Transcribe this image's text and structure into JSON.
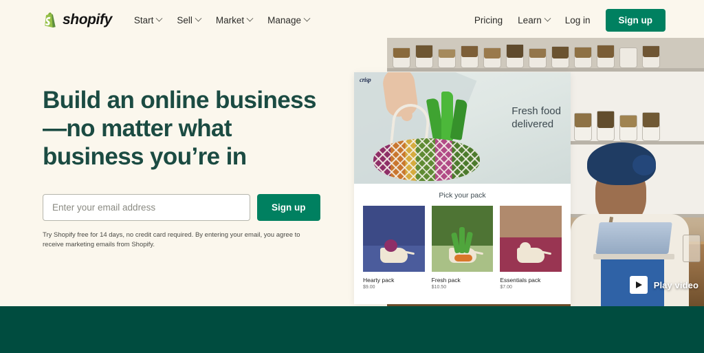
{
  "colors": {
    "page_background": "#fbf7ed",
    "brand_green": "#008060",
    "headline_green": "#1b4b42",
    "footer_band": "#004c3f"
  },
  "nav": {
    "logo_text": "shopify",
    "logo_icon": "shopify-bag-icon",
    "links": [
      {
        "label": "Start",
        "icon": "chevron-down-icon"
      },
      {
        "label": "Sell",
        "icon": "chevron-down-icon"
      },
      {
        "label": "Market",
        "icon": "chevron-down-icon"
      },
      {
        "label": "Manage",
        "icon": "chevron-down-icon"
      }
    ],
    "right": {
      "pricing": "Pricing",
      "learn": "Learn",
      "learn_icon": "chevron-down-icon",
      "login": "Log in",
      "signup": "Sign up"
    }
  },
  "hero": {
    "headline_line1": "Build an online business",
    "headline_line2": "—no matter what",
    "headline_line3": "business you’re in",
    "email_placeholder": "Enter your email address",
    "email_value": "",
    "signup_button": "Sign up",
    "disclaimer": "Try Shopify free for 14 days, no credit card required. By entering your email, you agree to receive marketing emails from Shopify."
  },
  "product_card": {
    "store_logo": "crisp",
    "tagline_line1": "Fresh food",
    "tagline_line2": "delivered",
    "section_title": "Pick your pack",
    "items": [
      {
        "name": "Hearty pack",
        "price": "$9.00",
        "bg": "#3c4a86",
        "floor": "#4b5c9c"
      },
      {
        "name": "Fresh pack",
        "price": "$10.50",
        "bg": "#4e7434",
        "floor": "#a9c086"
      },
      {
        "name": "Essentials pack",
        "price": "$7.00",
        "bg": "#b08a6d",
        "floor": "#993552"
      }
    ]
  },
  "video": {
    "play_label": "Play video",
    "play_icon": "play-triangle-icon"
  }
}
